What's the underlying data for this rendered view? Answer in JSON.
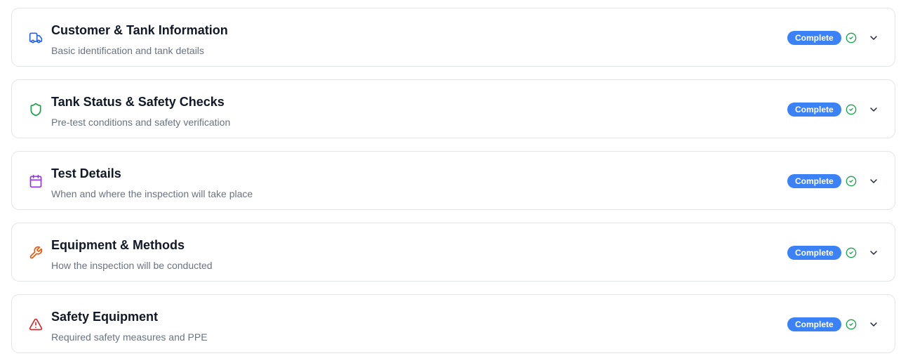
{
  "colors": {
    "badge": "#3b82f6",
    "check": "#16a34a",
    "truck_icon": "#2563eb",
    "shield_icon": "#16a34a",
    "calendar_icon": "#9333ea",
    "wrench_icon": "#ea580c",
    "warning_icon": "#dc2626"
  },
  "sections": [
    {
      "icon": "truck-icon",
      "title": "Customer & Tank Information",
      "subtitle": "Basic identification and tank details",
      "status": "Complete"
    },
    {
      "icon": "shield-icon",
      "title": "Tank Status & Safety Checks",
      "subtitle": "Pre-test conditions and safety verification",
      "status": "Complete"
    },
    {
      "icon": "calendar-icon",
      "title": "Test Details",
      "subtitle": "When and where the inspection will take place",
      "status": "Complete"
    },
    {
      "icon": "wrench-icon",
      "title": "Equipment & Methods",
      "subtitle": "How the inspection will be conducted",
      "status": "Complete"
    },
    {
      "icon": "warning-icon",
      "title": "Safety Equipment",
      "subtitle": "Required safety measures and PPE",
      "status": "Complete"
    }
  ]
}
